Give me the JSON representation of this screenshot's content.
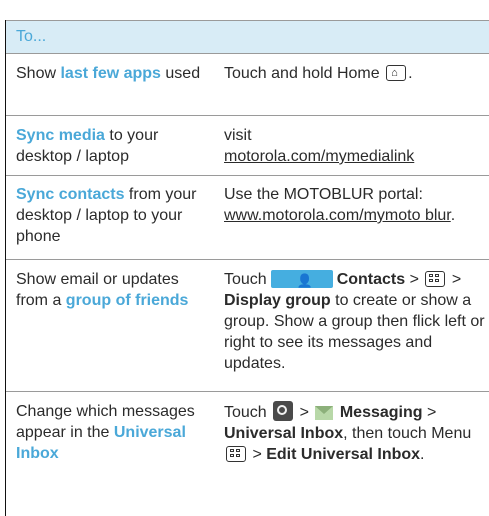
{
  "header": {
    "label": "To..."
  },
  "rows": [
    {
      "c1_pre": "Show ",
      "c1_bold": "last few apps",
      "c1_post": " used",
      "c2_text": "Touch and hold Home ",
      "c2_end": "."
    },
    {
      "c1_bold": "Sync media",
      "c1_post": " to your desktop / laptop",
      "c2_text": "visit",
      "c2_link": "motorola.com/mymedialink"
    },
    {
      "c1_bold": "Sync contacts",
      "c1_post": " from your desktop / laptop to your phone",
      "c2_text": "Use the MOTOBLUR portal:",
      "c2_link": "www.motorola.com/mymoto blur",
      "c2_end": "."
    },
    {
      "c1_pre": "Show email or updates from a ",
      "c1_bold": "group of friends",
      "c2_touch": "Touch",
      "c2_contacts": "Contacts",
      "c2_gt1": " > ",
      "c2_gt2": " > ",
      "c2_display": "Display group",
      "c2_rest": " to create or show a group. Show a group then flick left or right to see its messages and updates."
    },
    {
      "c1_pre": "Change which messages appear in the ",
      "c1_bold": "Universal Inbox",
      "c2_touch": "Touch",
      "c2_gt1": " > ",
      "c2_messaging": "Messaging",
      "c2_gt2": " > ",
      "c2_ui": "Universal Inbox",
      "c2_then": ", then touch Menu ",
      "c2_gt3": " > ",
      "c2_edit": "Edit Universal Inbox",
      "c2_end": "."
    }
  ],
  "icons": {
    "home": "home-key-icon",
    "menu": "menu-key-icon",
    "contacts": "contacts-app-icon",
    "launcher": "launcher-icon",
    "messaging": "messaging-icon"
  },
  "colors": {
    "accent": "#4aa8d8",
    "header_bg": "#d8ecf6",
    "contacts_icon": "#45aee0"
  }
}
